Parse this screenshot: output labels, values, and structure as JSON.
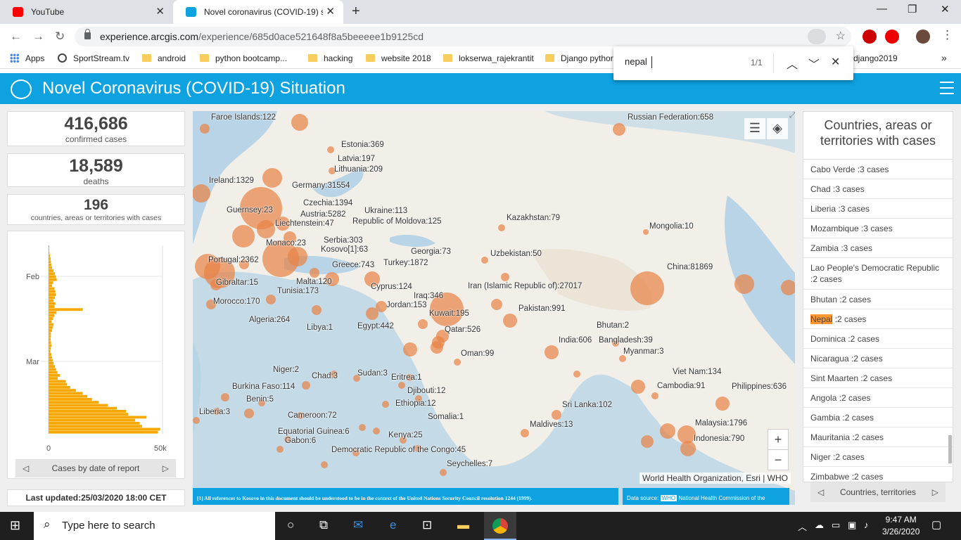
{
  "browser": {
    "tabs": [
      {
        "label": "YouTube"
      },
      {
        "label": "Novel coronavirus (COVID-19) sit"
      }
    ],
    "url_host": "experience.arcgis.com",
    "url_path": "/experience/685d0ace521648f8a5beeeee1b9125cd",
    "bookmarks": [
      "Apps",
      "SportStream.tv",
      "android",
      "python bootcamp...",
      "hacking",
      "website 2018",
      "lokserwa_rajekrantit",
      "Django pythor",
      "django2019"
    ],
    "find": {
      "query": "nepal",
      "count": "1/1"
    }
  },
  "app": {
    "title": "Novel Coronavirus (COVID-19) Situation"
  },
  "stats": [
    {
      "value": "416,686",
      "label": "confirmed cases"
    },
    {
      "value": "18,589",
      "label": "deaths"
    },
    {
      "value": "196",
      "label": "countries, areas or territories with cases"
    }
  ],
  "epicurve": {
    "month_labels": [
      "Feb",
      "Mar"
    ],
    "x_ticks": [
      "0",
      "50k"
    ],
    "nav_label": "Cases by date of report"
  },
  "chart_data": {
    "type": "bar",
    "orientation": "horizontal",
    "title": "Cases by date of report",
    "xlabel": "",
    "ylabel": "",
    "xlim": [
      0,
      50000
    ],
    "y_month_labels": [
      "Feb",
      "Mar"
    ],
    "values": [
      200,
      300,
      400,
      600,
      900,
      1000,
      1200,
      1500,
      2200,
      2800,
      3200,
      3600,
      2000,
      1500,
      2600,
      3000,
      3200,
      2800,
      2200,
      3000,
      2600,
      15000,
      3500,
      2500,
      2000,
      1300,
      2200,
      1800,
      1500,
      1000,
      1000,
      900,
      1100,
      1300,
      1000,
      800,
      1200,
      1500,
      1800,
      2200,
      2800,
      3300,
      3900,
      5000,
      4000,
      7500,
      8000,
      9500,
      12000,
      15000,
      17000,
      19000,
      22000,
      26000,
      30000,
      34000,
      35000,
      43000,
      38000,
      40000,
      41000,
      49000,
      48000
    ]
  },
  "last_updated": "Last updated:25/03/2020 18:00 CET",
  "map": {
    "labels": [
      {
        "text": "Faroe Islands:122",
        "l": 26,
        "t": 3
      },
      {
        "text": "Russian Federation:658",
        "l": 618,
        "t": 3
      },
      {
        "text": "Estonia:369",
        "l": 211,
        "t": 42
      },
      {
        "text": "Latvia:197",
        "l": 206,
        "t": 62
      },
      {
        "text": "Lithuania:209",
        "l": 201,
        "t": 77
      },
      {
        "text": "Ireland:1329",
        "l": 23,
        "t": 93
      },
      {
        "text": "Germany:31554",
        "l": 141,
        "t": 100
      },
      {
        "text": "Czechia:1394",
        "l": 157,
        "t": 125
      },
      {
        "text": "Guernsey:23",
        "l": 48,
        "t": 135
      },
      {
        "text": "Ukraine:113",
        "l": 244,
        "t": 136
      },
      {
        "text": "Austria:5282",
        "l": 153,
        "t": 141
      },
      {
        "text": "Kazakhstan:79",
        "l": 446,
        "t": 146
      },
      {
        "text": "Republic of Moldova:125",
        "l": 227,
        "t": 151
      },
      {
        "text": "Liechtenstein:47",
        "l": 117,
        "t": 154
      },
      {
        "text": "Mongolia:10",
        "l": 649,
        "t": 158
      },
      {
        "text": "Serbia:303",
        "l": 186,
        "t": 178
      },
      {
        "text": "Monaco:23",
        "l": 104,
        "t": 182
      },
      {
        "text": "Kosovo[1]:63",
        "l": 182,
        "t": 191
      },
      {
        "text": "Georgia:73",
        "l": 310,
        "t": 194
      },
      {
        "text": "Uzbekistan:50",
        "l": 423,
        "t": 197
      },
      {
        "text": "Portugal:2362",
        "l": 22,
        "t": 206
      },
      {
        "text": "Turkey:1872",
        "l": 271,
        "t": 210
      },
      {
        "text": "Greece:743",
        "l": 198,
        "t": 213
      },
      {
        "text": "China:81869",
        "l": 674,
        "t": 216
      },
      {
        "text": "Malta:120",
        "l": 147,
        "t": 237
      },
      {
        "text": "Gibraltar:15",
        "l": 33,
        "t": 238
      },
      {
        "text": "Cyprus:124",
        "l": 253,
        "t": 244
      },
      {
        "text": "Iran (Islamic Republic of):27017",
        "l": 391,
        "t": 243
      },
      {
        "text": "Tunisia:173",
        "l": 120,
        "t": 250
      },
      {
        "text": "Iraq:346",
        "l": 314,
        "t": 257
      },
      {
        "text": "Morocco:170",
        "l": 29,
        "t": 265
      },
      {
        "text": "Jordan:153",
        "l": 275,
        "t": 270
      },
      {
        "text": "Pakistan:991",
        "l": 463,
        "t": 275
      },
      {
        "text": "Kuwait:195",
        "l": 336,
        "t": 282
      },
      {
        "text": "Algeria:264",
        "l": 80,
        "t": 291
      },
      {
        "text": "Bhutan:2",
        "l": 574,
        "t": 299
      },
      {
        "text": "Libya:1",
        "l": 162,
        "t": 302
      },
      {
        "text": "Egypt:442",
        "l": 234,
        "t": 300
      },
      {
        "text": "Qatar:526",
        "l": 358,
        "t": 305
      },
      {
        "text": "India:606",
        "l": 520,
        "t": 320
      },
      {
        "text": "Bangladesh:39",
        "l": 577,
        "t": 320
      },
      {
        "text": "Myanmar:3",
        "l": 612,
        "t": 336
      },
      {
        "text": "Oman:99",
        "l": 381,
        "t": 339
      },
      {
        "text": "Niger:2",
        "l": 114,
        "t": 362
      },
      {
        "text": "Viet Nam:134",
        "l": 682,
        "t": 365
      },
      {
        "text": "Sudan:3",
        "l": 234,
        "t": 367
      },
      {
        "text": "Chad:3",
        "l": 169,
        "t": 371
      },
      {
        "text": "Eritrea:1",
        "l": 282,
        "t": 373
      },
      {
        "text": "Cambodia:91",
        "l": 660,
        "t": 385
      },
      {
        "text": "Philippines:636",
        "l": 766,
        "t": 386
      },
      {
        "text": "Burkina Faso:114",
        "l": 56,
        "t": 386
      },
      {
        "text": "Djibouti:12",
        "l": 305,
        "t": 392
      },
      {
        "text": "Benin:5",
        "l": 76,
        "t": 404
      },
      {
        "text": "Ethiopia:12",
        "l": 288,
        "t": 410
      },
      {
        "text": "Sri Lanka:102",
        "l": 525,
        "t": 412
      },
      {
        "text": "Liberia:3",
        "l": 9,
        "t": 422
      },
      {
        "text": "Cameroon:72",
        "l": 135,
        "t": 427
      },
      {
        "text": "Somalia:1",
        "l": 334,
        "t": 429
      },
      {
        "text": "Maldives:13",
        "l": 479,
        "t": 440
      },
      {
        "text": "Malaysia:1796",
        "l": 714,
        "t": 438
      },
      {
        "text": "Equatorial Guinea:6",
        "l": 121,
        "t": 450
      },
      {
        "text": "Kenya:25",
        "l": 278,
        "t": 455
      },
      {
        "text": "Indonesia:790",
        "l": 712,
        "t": 460
      },
      {
        "text": "Gabon:6",
        "l": 131,
        "t": 463
      },
      {
        "text": "Democratic Republic of the Congo:45",
        "l": 197,
        "t": 476
      },
      {
        "text": "Seychelles:7",
        "l": 361,
        "t": 496
      }
    ],
    "footer_note": "[1] All references to Kosovo in this document should be understood to be in the context of the United Nations Security Council resolution 1244 (1999).",
    "data_source_label": "Data source:",
    "data_source_who": "WHO",
    "data_source_rest": "National Health Commission of the",
    "attribution": "World Health Organization, Esri | WHO"
  },
  "list": {
    "title": "Countries, areas or territories with cases",
    "items": [
      {
        "name": "Cabo Verde",
        "cases": " :3 cases"
      },
      {
        "name": "Chad",
        "cases": " :3 cases"
      },
      {
        "name": "Liberia",
        "cases": " :3 cases"
      },
      {
        "name": "Mozambique",
        "cases": " :3 cases"
      },
      {
        "name": "Zambia",
        "cases": " :3 cases"
      },
      {
        "name": "Lao People's Democratic Republic",
        "cases": " :2 cases"
      },
      {
        "name": "Bhutan",
        "cases": " :2 cases"
      },
      {
        "name": "Nepal",
        "cases": " :2 cases"
      },
      {
        "name": "Dominica",
        "cases": " :2 cases"
      },
      {
        "name": "Nicaragua",
        "cases": " :2 cases"
      },
      {
        "name": "Sint Maarten",
        "cases": " :2 cases"
      },
      {
        "name": "Angola",
        "cases": " :2 cases"
      },
      {
        "name": "Gambia",
        "cases": " :2 cases"
      },
      {
        "name": "Mauritania",
        "cases": " :2 cases"
      },
      {
        "name": "Niger",
        "cases": " :2 cases"
      },
      {
        "name": "Zimbabwe",
        "cases": " :2 cases"
      }
    ],
    "nav_label": "Countries, territories"
  },
  "taskbar": {
    "search_placeholder": "Type here to search",
    "time": "9:47 AM",
    "date": "3/26/2020"
  }
}
